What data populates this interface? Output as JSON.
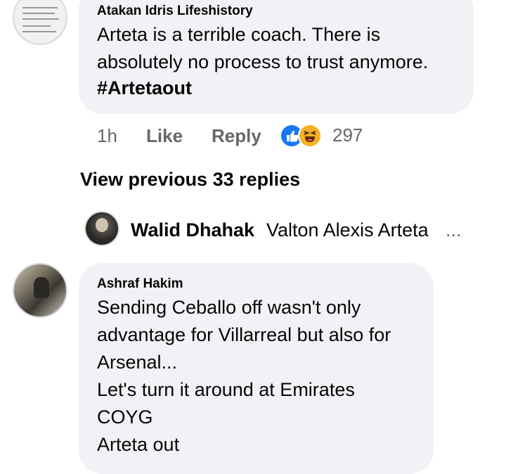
{
  "comments": [
    {
      "author": "Atakan Idris Lifeshistory",
      "text": "Arteta is a terrible coach. There is\nabsolutely no process to trust anymore.",
      "hashtag": "#Artetaout",
      "time": "1h",
      "like_label": "Like",
      "reply_label": "Reply",
      "reaction_icons": [
        "like-icon",
        "haha-icon"
      ],
      "reaction_count": "297"
    },
    {
      "author": "Ashraf Hakim",
      "text": "Sending Ceballo off wasn't only\nadvantage for Villarreal but also for\nArsenal...\nLet's turn it around at Emirates\nCOYG\nArteta out"
    }
  ],
  "view_previous": "View previous 33 replies",
  "reply_preview": {
    "author": "Walid Dhahak",
    "snippet": "Valton Alexis Arteta",
    "ellipsis": "..."
  },
  "colors": {
    "bubble": "#f0f2f5",
    "meta_text": "#65676b",
    "like_blue": "#1877f2",
    "haha_yellow": "#f7b125"
  }
}
